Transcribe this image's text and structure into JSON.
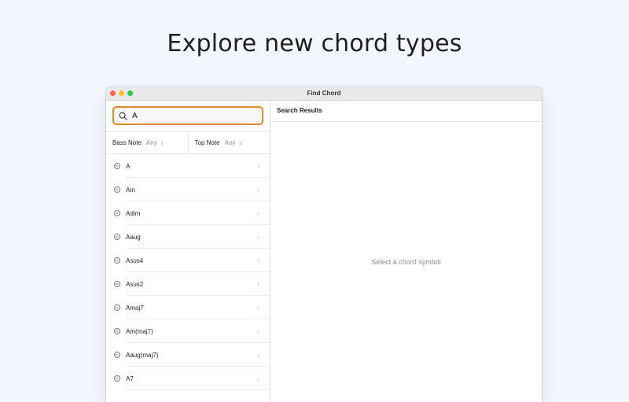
{
  "headline": "Explore new chord types",
  "window": {
    "title": "Find Chord"
  },
  "search": {
    "value": "A",
    "icon": "search-icon"
  },
  "filters": [
    {
      "label": "Bass Note",
      "value": "Any"
    },
    {
      "label": "Top Note",
      "value": "Any"
    }
  ],
  "chords": [
    {
      "label": "A"
    },
    {
      "label": "Am"
    },
    {
      "label": "Adim"
    },
    {
      "label": "Aaug"
    },
    {
      "label": "Asus4"
    },
    {
      "label": "Asus2"
    },
    {
      "label": "Amaj7"
    },
    {
      "label": "Am(maj7)"
    },
    {
      "label": "Aaug(maj7)"
    },
    {
      "label": "A7"
    }
  ],
  "results": {
    "header": "Search Results",
    "empty_message": "Select a chord symbol"
  },
  "colors": {
    "accent": "#e08a2a",
    "background": "#f3f6fc"
  }
}
